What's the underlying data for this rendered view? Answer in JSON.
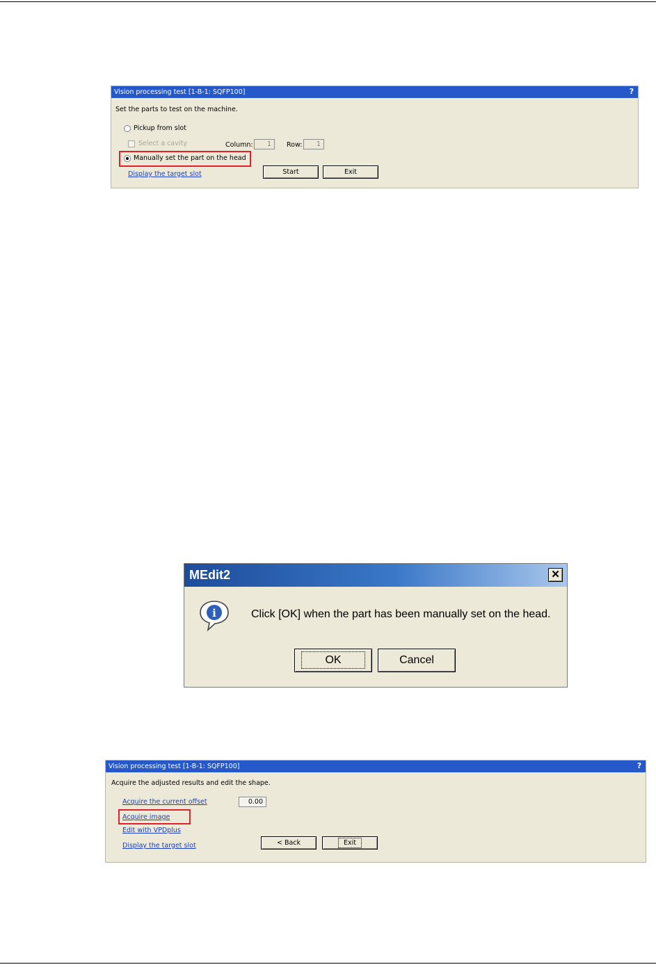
{
  "panel1": {
    "title": "Vision processing test [1-B-1: SQFP100]",
    "instruction": "Set the parts to test on the machine.",
    "radio_pickup": "Pickup from slot",
    "checkbox_cavity": "Select a cavity",
    "column_label": "Column:",
    "column_value": "1",
    "row_label": "Row:",
    "row_value": "1",
    "radio_manual": "Manually set the part on the head",
    "link_display": "Display the target slot",
    "start_button": "Start",
    "exit_button": "Exit"
  },
  "dialog": {
    "title": "MEdit2",
    "close_glyph": "✕",
    "info_glyph": "i",
    "message": "Click [OK] when the part has been manually set on the head.",
    "ok_button": "OK",
    "cancel_button": "Cancel"
  },
  "panel2": {
    "title": "Vision processing test [1-B-1: SQFP100]",
    "instruction": "Acquire the adjusted results and edit the shape.",
    "link_offset": "Acquire the current offset",
    "offset_value": "0.00",
    "link_image": "Acquire image",
    "link_vpd": "Edit with VPDplus",
    "link_display": "Display the target slot",
    "back_button": "< Back",
    "exit_button": "Exit"
  },
  "colors": {
    "highlight": "#e0202a",
    "panel_title_bar": "#2558c8",
    "dialog_title_start": "#1d4c9b",
    "link": "#1c3fb7"
  }
}
